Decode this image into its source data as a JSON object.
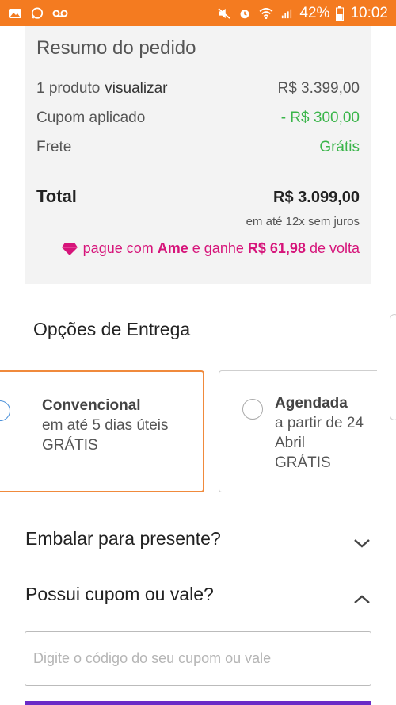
{
  "status_bar": {
    "battery": "42%",
    "time": "10:02",
    "background": "#f47b20"
  },
  "summary": {
    "title": "Resumo do pedido",
    "product_count": "1 produto",
    "view_link": "visualizar",
    "product_price": "R$ 3.399,00",
    "coupon_label": "Cupom aplicado",
    "coupon_value": "- R$ 300,00",
    "shipping_label": "Frete",
    "shipping_value": "Grátis",
    "total_label": "Total",
    "total_value": "R$ 3.099,00",
    "installments": "em até 12x sem juros",
    "ame_prefix": "pague com",
    "ame_brand": "Ame",
    "ame_middle": "e ganhe",
    "ame_amount": "R$ 61,98",
    "ame_suffix": "de volta"
  },
  "delivery": {
    "title": "Opções de Entrega",
    "options": [
      {
        "name": "Convencional",
        "line1": "em até 5 dias úteis",
        "line2": "GRÁTIS",
        "selected": true
      },
      {
        "name": "Agendada",
        "line1": "a partir de 24",
        "line2": "Abril",
        "line3": "GRÁTIS",
        "selected": false
      }
    ]
  },
  "gift": {
    "label": "Embalar para presente?",
    "icon": "chevron-down-icon"
  },
  "coupon": {
    "label": "Possui cupom ou vale?",
    "icon": "chevron-up-icon",
    "placeholder": "Digite o código do seu cupom ou vale",
    "value": ""
  },
  "colors": {
    "accent": "#f08a3c",
    "green": "#3ab54a",
    "ame": "#d6147a",
    "purple": "#6a2bc7"
  }
}
